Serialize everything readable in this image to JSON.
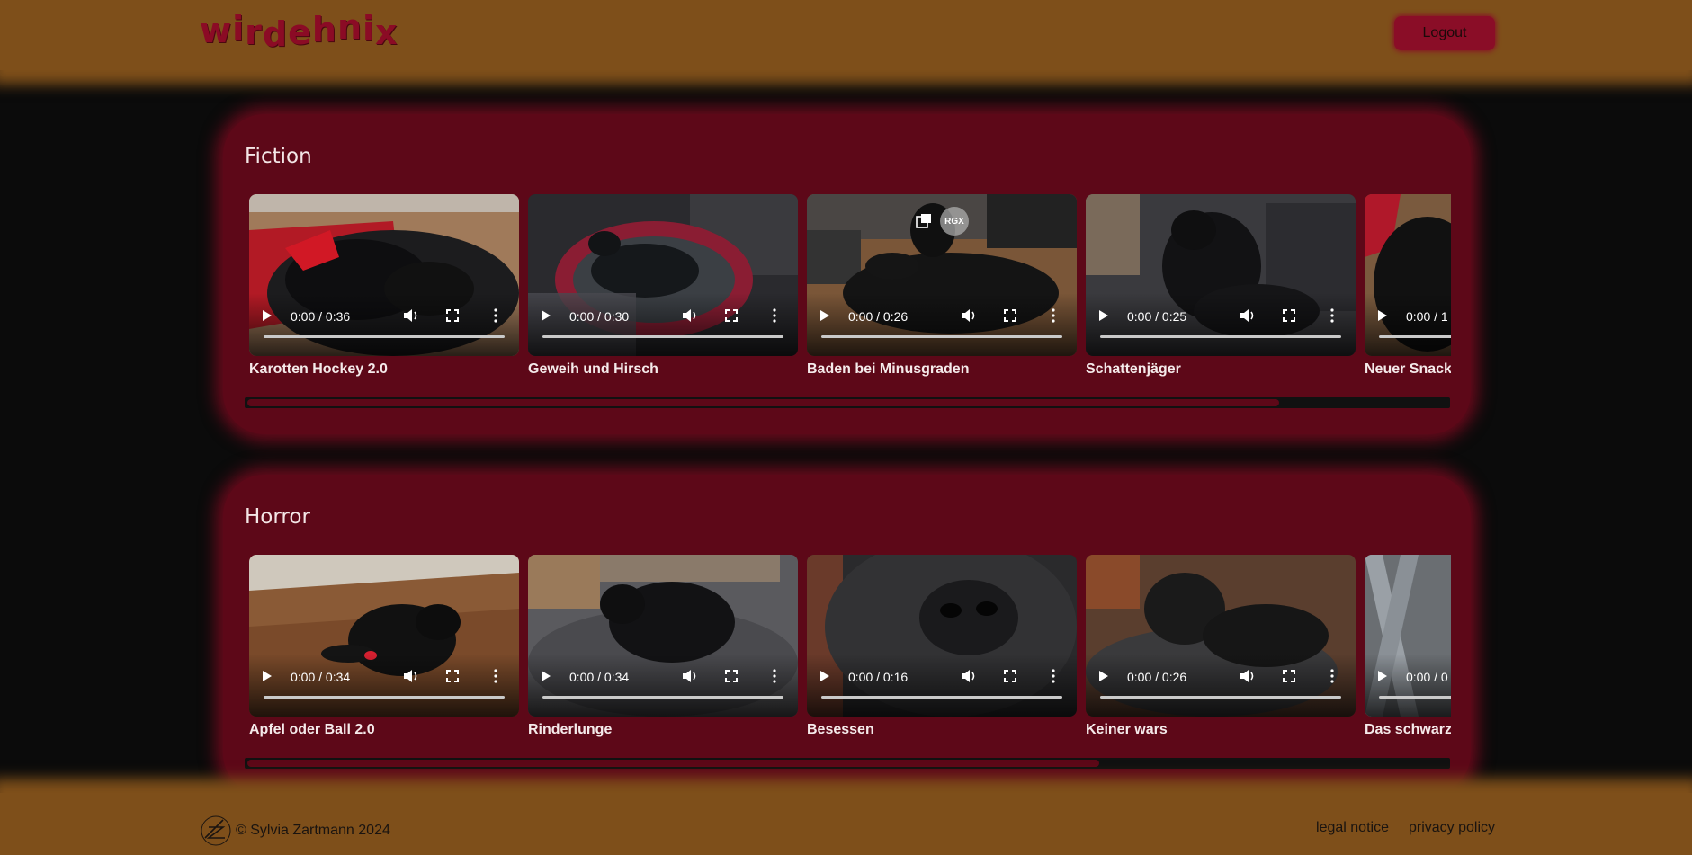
{
  "header": {
    "logo_text": "wirdehnix",
    "logout_label": "Logout",
    "colors": {
      "bar": "#7e4f1a",
      "accent": "#8a0d27"
    }
  },
  "sections": [
    {
      "title": "Fiction",
      "scroll_fraction": 0.86,
      "videos": [
        {
          "title": "Karotten Hockey 2.0",
          "time": "0:00 / 0:36",
          "scene": "dog-in-red-bed"
        },
        {
          "title": "Geweih und Hirsch",
          "time": "0:00 / 0:30",
          "scene": "dog-on-pink-cushion"
        },
        {
          "title": "Baden bei Minusgraden",
          "time": "0:00 / 0:26",
          "scene": "dog-on-floor",
          "overlay": [
            "picture-in-picture-icon",
            "RGX"
          ]
        },
        {
          "title": "Schattenjäger",
          "time": "0:00 / 0:25",
          "scene": "puppy-on-couch"
        },
        {
          "title": "Neuer Snack",
          "time": "0:00 / 1",
          "scene": "dog-partial"
        }
      ]
    },
    {
      "title": "Horror",
      "scroll_fraction": 0.71,
      "videos": [
        {
          "title": "Apfel oder Ball 2.0",
          "time": "0:00 / 0:34",
          "scene": "dog-on-wood-floor"
        },
        {
          "title": "Rinderlunge",
          "time": "0:00 / 0:34",
          "scene": "dog-curled-on-couch"
        },
        {
          "title": "Besessen",
          "time": "0:00 / 0:16",
          "scene": "dog-nose-closeup"
        },
        {
          "title": "Keiner wars",
          "time": "0:00 / 0:26",
          "scene": "puppy-lying"
        },
        {
          "title": "Das schwarze",
          "time": "0:00 / 0",
          "scene": "dog-partial-cage"
        }
      ]
    }
  ],
  "footer": {
    "copyright": "© Sylvia Zartmann 2024",
    "links": [
      "legal notice",
      "privacy policy"
    ]
  }
}
